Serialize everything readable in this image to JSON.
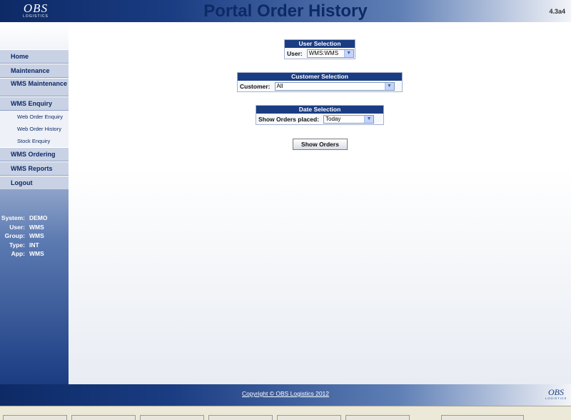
{
  "header": {
    "logo_main": "OBS",
    "logo_sub": "LOGISTICS",
    "title": "Portal Order History",
    "version": "4.3a4"
  },
  "sidebar": {
    "menu": [
      {
        "label": "Home"
      },
      {
        "label": "Maintenance"
      },
      {
        "label": "WMS Maintenance"
      },
      {
        "label": "WMS Enquiry"
      }
    ],
    "submenu": [
      {
        "label": "Web Order Enquiry"
      },
      {
        "label": "Web Order History"
      },
      {
        "label": "Stock Enquiry"
      }
    ],
    "menu_after": [
      {
        "label": "WMS Ordering"
      },
      {
        "label": "WMS Reports"
      },
      {
        "label": "Logout"
      }
    ],
    "info": [
      {
        "label": "System:",
        "value": "DEMO"
      },
      {
        "label": "User:",
        "value": "WMS"
      },
      {
        "label": "Group:",
        "value": "WMS"
      },
      {
        "label": "Type:",
        "value": "INT"
      },
      {
        "label": "App:",
        "value": "WMS"
      }
    ]
  },
  "user_selection": {
    "title": "User Selection",
    "label": "User:",
    "value": "WMS:WMS"
  },
  "customer_selection": {
    "title": "Customer Selection",
    "label": "Customer:",
    "value": "All"
  },
  "date_selection": {
    "title": "Date Selection",
    "label": "Show Orders placed:",
    "value": "Today"
  },
  "show_orders_label": "Show Orders",
  "footer": {
    "copyright": "Copyright © OBS Logistics 2012",
    "logo_main": "OBS",
    "logo_sub": "LOGISTICS"
  },
  "colors": {
    "brand_navy": "#0d2a66",
    "accent_blue": "#1a3c82"
  }
}
